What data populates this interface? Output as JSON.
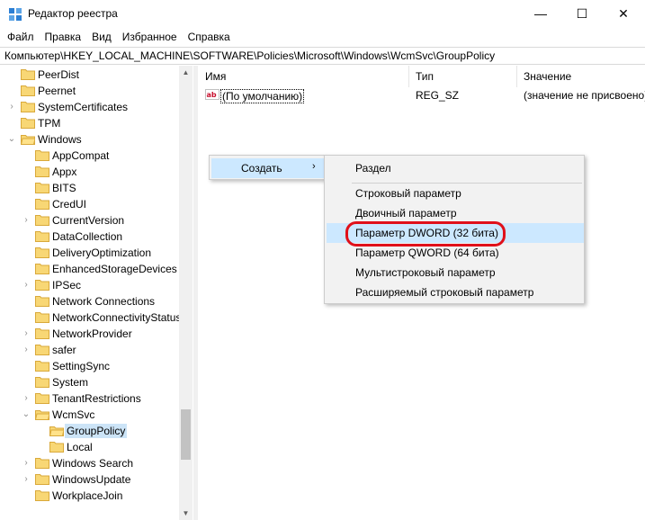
{
  "window": {
    "title": "Редактор реестра",
    "minimize_glyph": "—",
    "maximize_glyph": "☐",
    "close_glyph": "✕",
    "icon": "registry-editor-icon"
  },
  "menu": [
    "Файл",
    "Правка",
    "Вид",
    "Избранное",
    "Справка"
  ],
  "address": "Компьютер\\HKEY_LOCAL_MACHINE\\SOFTWARE\\Policies\\Microsoft\\Windows\\WcmSvc\\GroupPolicy",
  "tree": [
    {
      "label": "PeerDist",
      "chevron": ""
    },
    {
      "label": "Peernet",
      "chevron": ""
    },
    {
      "label": "SystemCertificates",
      "chevron": "›"
    },
    {
      "label": "TPM",
      "chevron": ""
    },
    {
      "label": "Windows",
      "chevron": "⌄"
    },
    {
      "label": "AppCompat",
      "chevron": ""
    },
    {
      "label": "Appx",
      "chevron": ""
    },
    {
      "label": "BITS",
      "chevron": ""
    },
    {
      "label": "CredUI",
      "chevron": ""
    },
    {
      "label": "CurrentVersion",
      "chevron": "›"
    },
    {
      "label": "DataCollection",
      "chevron": ""
    },
    {
      "label": "DeliveryOptimization",
      "chevron": ""
    },
    {
      "label": "EnhancedStorageDevices",
      "chevron": ""
    },
    {
      "label": "IPSec",
      "chevron": "›"
    },
    {
      "label": "Network Connections",
      "chevron": ""
    },
    {
      "label": "NetworkConnectivityStatus",
      "chevron": ""
    },
    {
      "label": "NetworkProvider",
      "chevron": "›"
    },
    {
      "label": "safer",
      "chevron": "›"
    },
    {
      "label": "SettingSync",
      "chevron": ""
    },
    {
      "label": "System",
      "chevron": ""
    },
    {
      "label": "TenantRestrictions",
      "chevron": "›"
    },
    {
      "label": "WcmSvc",
      "chevron": "⌄"
    },
    {
      "label": "GroupPolicy",
      "chevron": ""
    },
    {
      "label": "Local",
      "chevron": ""
    },
    {
      "label": "Windows Search",
      "chevron": "›"
    },
    {
      "label": "WindowsUpdate",
      "chevron": "›"
    },
    {
      "label": "WorkplaceJoin",
      "chevron": ""
    }
  ],
  "columns": {
    "name": "Имя",
    "type": "Тип",
    "value": "Значение"
  },
  "rows": [
    {
      "name": "(По умолчанию)",
      "type": "REG_SZ",
      "value": "(значение не присвоено)"
    }
  ],
  "context_menu": {
    "create_label": "Создать",
    "create_arrow": "›",
    "submenu": [
      "Раздел",
      "Строковый параметр",
      "Двоичный параметр",
      "Параметр DWORD (32 бита)",
      "Параметр QWORD (64 бита)",
      "Мультистроковый параметр",
      "Расширяемый строковый параметр"
    ]
  },
  "scroll": {
    "up": "▲",
    "down": "▼"
  },
  "colors": {
    "selection": "#cce4f7",
    "menu_hover": "#cce8ff",
    "highlight_ring": "#e0101a",
    "folder": "#f2c94c"
  }
}
